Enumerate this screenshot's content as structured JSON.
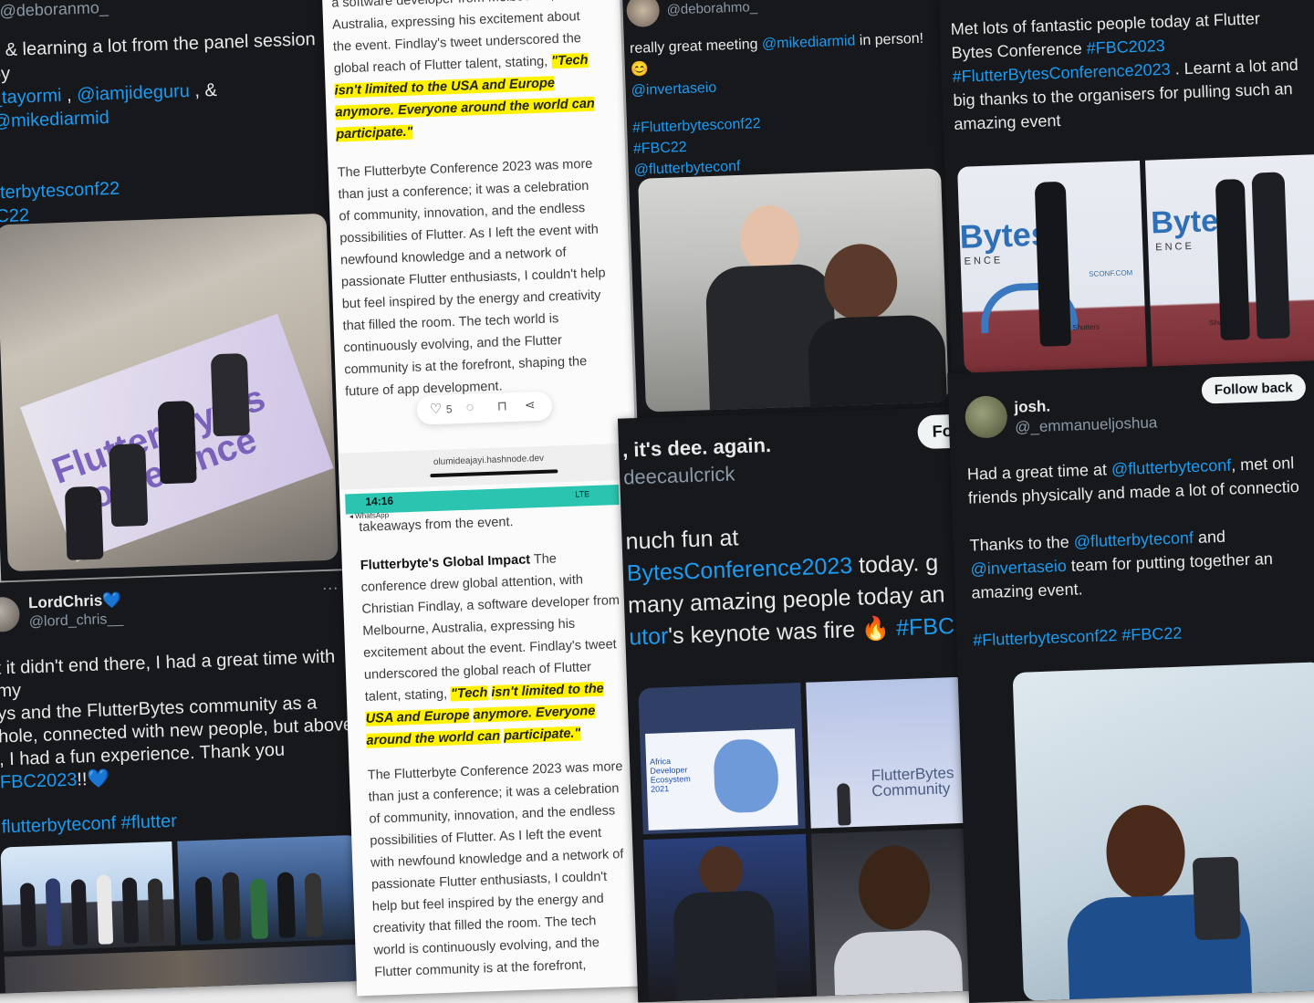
{
  "card1": {
    "handle": "@deboranmo_",
    "line1": "g & learning a lot from the panel session by",
    "mentions": [
      "_tayormi",
      "@iamjideguru",
      "@mikediarmid"
    ],
    "sep1": " , ",
    "sep2": " , & ",
    "tags": [
      "tterbytesconf22",
      "C22",
      "tterbyteconf"
    ],
    "banner_text": "Flutter Bytes Conference"
  },
  "card2": {
    "name": "LordChris",
    "heart": "💙",
    "handle": "@lord_chris__",
    "menu": "···",
    "text_lines": [
      "t it didn't end there, I had a great time with my",
      "ys and the FlutterBytes community as a",
      "hole, connected with new people, but above",
      ", I had a fun experience. Thank you"
    ],
    "last_tag": "FBC2023",
    "last_tail": "!!💙",
    "tags": "flutterbyteconf #flutter"
  },
  "article": {
    "top_lines": [
      "a software developer from Melbourne,",
      "Australia, expressing his excitement about",
      "the event. Findlay's tweet underscored the",
      "global reach of Flutter talent, stating,"
    ],
    "quote": [
      "\"Tech",
      "isn't limited to the USA and Europe",
      "anymore. Everyone around the world can",
      "participate.\""
    ],
    "paragraph": "The Flutterbyte Conference 2023 was more than just a conference; it was a celebration of community, innovation, and the endless possibilities of Flutter. As I left the event with newfound knowledge and a network of passionate Flutter enthusiasts, I couldn't help but feel inspired by the energy and creativity that filled the room. The tech world is continuously evolving, and the Flutter community is at the forefront, shaping the future of app development.",
    "like_count": "5",
    "url": "olumideajayi.hashnode.dev",
    "status_time": "14:16",
    "status_back": "◂ WhatsApp",
    "status_signal": "LTE",
    "cut_line": "takeaways from the event.",
    "impact_heading": "Flutterbyte's Global Impact",
    "impact_text": "The conference drew global attention, with Christian Findlay, a software developer from Melbourne, Australia, expressing his excitement about the event. Findlay's tweet underscored the global reach of Flutter talent, stating,",
    "paragraph2_lines": [
      "The Flutterbyte Conference 2023 was more",
      "than just a conference; it was a celebration",
      "of community, innovation, and the endless",
      "possibilities of Flutter. As I left the event",
      "with newfound knowledge and a network of",
      "passionate Flutter enthusiasts, I couldn't",
      "help but feel inspired by the energy and",
      "creativity that filled the room. The tech",
      "world is continuously evolving, and the",
      "Flutter community is at the forefront,"
    ]
  },
  "card3": {
    "handle": "@deborahmo_",
    "text": "really great meeting ",
    "mention": "@mikediarmid",
    "text2": " in person!😊",
    "mention2": "@invertaseio",
    "tags": [
      "#Flutterbytesconf22",
      "#FBC22",
      "@flutterbyteconf"
    ]
  },
  "card4": {
    "name": ", it's dee. again.",
    "handle": "deecaulcrick",
    "follow": "Fo",
    "l1": "nuch fun at",
    "l2_link": "BytesConference2023",
    "l2_tail": " today. g",
    "l3": "many amazing people today an",
    "l4_link": "utor",
    "l4_mid": "'s keynote was fire 🔥 ",
    "l4_tag": "#FBC",
    "slide_title": "Africa Developer Ecosystem 2021",
    "community_label": "FlutterBytes Community"
  },
  "card5": {
    "l1": "Met lots of fantastic people today at Flutter",
    "l2_pre": "Bytes Conference ",
    "l2_tag": "#FBC2023",
    "l3_tag": "#FlutterBytesConference2023",
    "l3_tail": " . Learnt a lot and",
    "l4": "big thanks to the organisers for pulling such an",
    "l5": "amazing event",
    "banner": "Bytes",
    "banner_sub": "ENCE",
    "banner_url": "SCONF.COM",
    "sponsor": "Shutters"
  },
  "card6": {
    "name": "josh.",
    "handle": "@_emmanueljoshua",
    "follow": "Follow back",
    "l1_pre": "Had a great time at ",
    "l1_link": "@flutterbyteconf",
    "l1_tail": ", met onl",
    "l2": "friends physically and made a lot of connectio",
    "l3_pre": "Thanks to the ",
    "l3_link": "@flutterbyteconf",
    "l3_tail": " and",
    "l4_link": "@invertaseio",
    "l4_tail": " team for putting together an",
    "l5": "amazing event.",
    "tags": "#Flutterbytesconf22 #FBC22"
  },
  "colors": {
    "link": "#1d9bf0",
    "dark_bg": "#16181c",
    "highlight": "#fff200",
    "status_bar": "#2bc4b0"
  }
}
